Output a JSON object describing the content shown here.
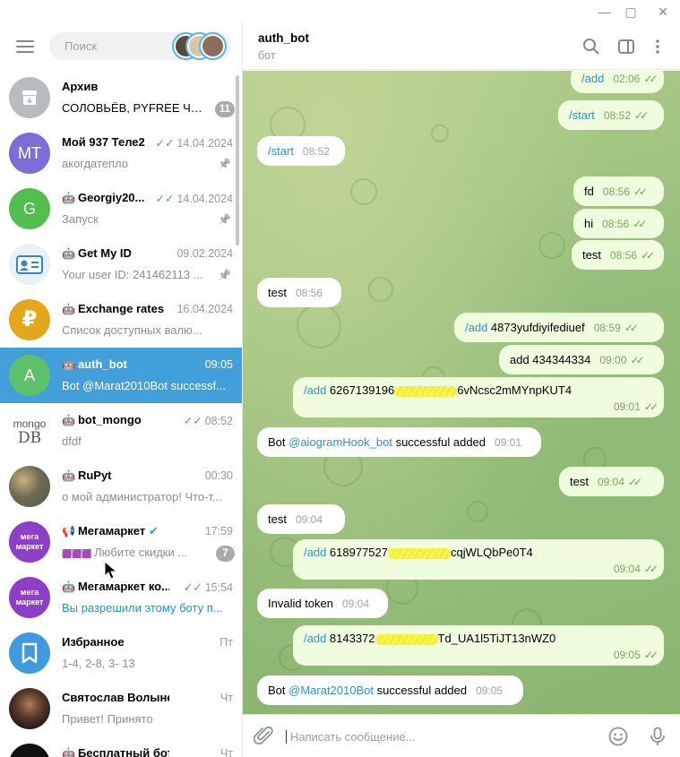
{
  "window": {
    "min_icon": "minimize-icon",
    "max_icon": "maximize-icon",
    "close_icon": "close-icon"
  },
  "search": {
    "placeholder": "Поиск"
  },
  "chats": [
    {
      "name": "Архив",
      "time": "",
      "preview": "СОЛОВЬЁВ, PYFREE Чат...",
      "badge": "11",
      "avatar_text": "",
      "avatar_color": "#b7bcc1",
      "bot": false
    },
    {
      "name": "Мой 937 Теле2",
      "time": "14.04.2024",
      "preview": "акогдатепло",
      "avatar_text": "MT",
      "avatar_color": "#7b6cd8",
      "bot": false,
      "read": true,
      "pinned": true
    },
    {
      "name": "Georgiy20...",
      "time": "14.04.2024",
      "preview": "Запуск",
      "avatar_text": "G",
      "avatar_color": "#52be4e",
      "bot": true,
      "read": true,
      "pinned": true
    },
    {
      "name": "Get My ID",
      "time": "09.02.2024",
      "preview": "Your user ID: 241462113 ...",
      "avatar_text": "",
      "avatar_color": "#e8f0f8",
      "bot": true,
      "pinned": true
    },
    {
      "name": "Exchange rates",
      "time": "16.04.2024",
      "preview": "Список доступных валю...",
      "avatar_text": "₽",
      "avatar_color": "#e4a61c",
      "bot": true
    },
    {
      "name": "auth_bot",
      "time": "09:05",
      "preview": "Bot @Marat2010Bot successf...",
      "avatar_text": "A",
      "avatar_color": "#5fc06b",
      "bot": true,
      "active": true
    },
    {
      "name": "bot_mongo",
      "time": "08:52",
      "preview": "dfdf",
      "avatar_text": "",
      "avatar_color": "#ffffff",
      "bot": true,
      "read": true
    },
    {
      "name": "RuPyt",
      "time": "00:30",
      "preview": "о мой администратор! Что-т...",
      "avatar_text": "",
      "avatar_color": "#8c8a76",
      "bot": true
    },
    {
      "name": "Мегамаркет",
      "time": "17:59",
      "preview": "Любите скидки ...",
      "badge": "7",
      "avatar_text": "мега маркет",
      "avatar_color": "#8e3fc8",
      "channel": true,
      "verified": true
    },
    {
      "name": "Мегамаркет ко...",
      "time": "15:54",
      "preview": "Вы разрешили этому боту п...",
      "avatar_text": "мега маркет",
      "avatar_color": "#8e3fc8",
      "bot": true,
      "read": true,
      "preview_blue": true
    },
    {
      "name": "Избранное",
      "time": "Пт",
      "preview": "1-4, 2-8, 3- 13",
      "avatar_text": "",
      "avatar_color": "#3f9ae0",
      "bot": false
    },
    {
      "name": "Святослав Волынец",
      "time": "Чт",
      "preview": "Привет! Принято",
      "avatar_text": "",
      "avatar_color": "#3b2a22",
      "bot": false
    },
    {
      "name": "Бесплатный бот One...",
      "time": "Чт",
      "preview": "",
      "avatar_text": "",
      "avatar_color": "#111111",
      "bot": true
    }
  ],
  "mongo_logo": {
    "top": "mongo",
    "bottom": "DB"
  },
  "conversation": {
    "title": "auth_bot",
    "subtitle": "бот",
    "messages": [
      {
        "dir": "out",
        "cmd": "/add",
        "text": "",
        "time": "02:06"
      },
      {
        "dir": "out",
        "cmd": "/start",
        "text": "",
        "time": "08:52"
      },
      {
        "dir": "in",
        "cmd": "/start",
        "text": "",
        "time": "08:52"
      },
      {
        "dir": "out",
        "cmd": "",
        "text": "fd",
        "time": "08:56"
      },
      {
        "dir": "out",
        "cmd": "",
        "text": "hi",
        "time": "08:56"
      },
      {
        "dir": "out",
        "cmd": "",
        "text": "test",
        "time": "08:56"
      },
      {
        "dir": "in",
        "cmd": "",
        "text": "test",
        "time": "08:56"
      },
      {
        "dir": "out",
        "cmd": "/add",
        "text": " 4873yufdiyifediuef",
        "time": "08:59"
      },
      {
        "dir": "out",
        "cmd": "",
        "text": "add 434344334",
        "time": "09:00"
      },
      {
        "dir": "out",
        "cmd": "/add",
        "text_a": " 6267139196",
        "text_b": "6vNcsc2mMYnpKUT4",
        "time": "09:01"
      },
      {
        "dir": "in",
        "text_a": "Bot ",
        "mention": "@aiogramHook_bot",
        "text_b": " successful added",
        "time": "09:01"
      },
      {
        "dir": "out",
        "cmd": "",
        "text": "test",
        "time": "09:04"
      },
      {
        "dir": "in",
        "cmd": "",
        "text": "test",
        "time": "09:04"
      },
      {
        "dir": "out",
        "cmd": "/add",
        "text_a": " 618977527",
        "text_b": "cqjWLQbPe0T4",
        "time": "09:04"
      },
      {
        "dir": "in",
        "cmd": "",
        "text": "Invalid token",
        "time": "09:04"
      },
      {
        "dir": "out",
        "cmd": "/add",
        "text_a": " 8143372",
        "text_b": "Td_UA1l5TiJT13nWZ0",
        "time": "09:05"
      },
      {
        "dir": "in",
        "text_a": "Bot ",
        "mention": "@Marat2010Bot",
        "text_b": " successful added",
        "time": "09:05"
      }
    ]
  },
  "composer": {
    "placeholder": "Написать сообщение..."
  }
}
